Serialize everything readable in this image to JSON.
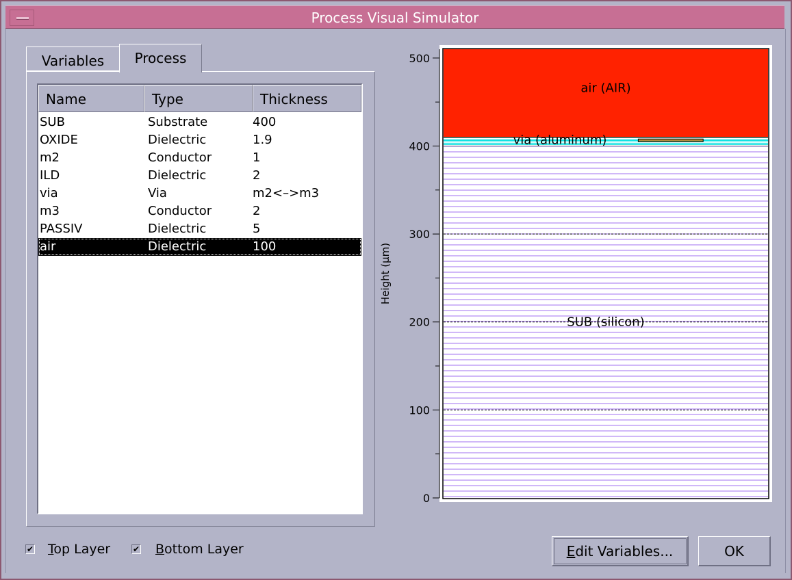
{
  "window": {
    "title": "Process Visual Simulator"
  },
  "tabs": [
    {
      "label": "Variables",
      "active": false
    },
    {
      "label": "Process",
      "active": true
    }
  ],
  "table": {
    "columns": [
      "Name",
      "Type",
      "Thickness"
    ],
    "rows": [
      {
        "name": "SUB",
        "type": "Substrate",
        "thickness": "400"
      },
      {
        "name": "OXIDE",
        "type": "Dielectric",
        "thickness": "1.9"
      },
      {
        "name": "m2",
        "type": "Conductor",
        "thickness": "1"
      },
      {
        "name": "ILD",
        "type": "Dielectric",
        "thickness": "2"
      },
      {
        "name": "via",
        "type": "Via",
        "thickness": "m2<–>m3"
      },
      {
        "name": "m3",
        "type": "Conductor",
        "thickness": "2"
      },
      {
        "name": "PASSIV",
        "type": "Dielectric",
        "thickness": "5"
      },
      {
        "name": "air",
        "type": "Dielectric",
        "thickness": "100",
        "selected": true
      }
    ]
  },
  "checkboxes": {
    "top_layer": {
      "mnemonic": "T",
      "rest": "op Layer",
      "checked": true
    },
    "bottom_layer": {
      "mnemonic": "B",
      "rest": "ottom Layer",
      "checked": true
    }
  },
  "buttons": {
    "edit_variables": {
      "mnemonic": "E",
      "rest": "dit Variables..."
    },
    "ok": "OK"
  },
  "chart_data": {
    "type": "area",
    "ylabel": "Height (µm)",
    "ylim": [
      0,
      510
    ],
    "yticks": [
      0,
      100,
      200,
      300,
      400,
      500
    ],
    "grid": "dashed",
    "layers": [
      {
        "label": "SUB (silicon)",
        "bottom": 0,
        "top": 400,
        "color": "#a070f0",
        "pattern": "horizontal-lines"
      },
      {
        "label": "via (aluminum)",
        "bottom": 400,
        "top": 410,
        "color": "#00e0e0",
        "pattern": "horizontal-lines"
      },
      {
        "label": "air (AIR)",
        "bottom": 410,
        "top": 510,
        "color": "#ff2200",
        "pattern": "solid"
      }
    ],
    "via_conductor": {
      "bottom": 405,
      "top": 408,
      "x_start": 0.6,
      "x_end": 0.8,
      "color": "#b08c3c"
    }
  }
}
